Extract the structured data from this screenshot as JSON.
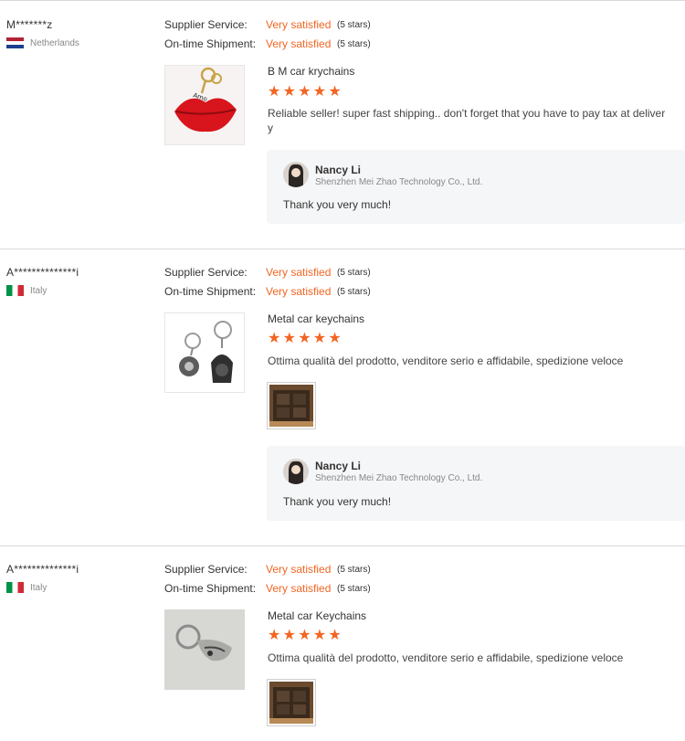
{
  "reviews": [
    {
      "buyer": "M*******z",
      "country": "Netherlands",
      "flag": "netherlands-flag",
      "supplier_label": "Supplier Service:",
      "supplier_value": "Very satisfied",
      "supplier_stars": "(5 stars)",
      "shipment_label": "On-time Shipment:",
      "shipment_value": "Very satisfied",
      "shipment_stars": "(5 stars)",
      "product_title": "B M car krychains",
      "rating": 5,
      "comment": "Reliable seller! super fast shipping.. don't forget that you have to pay tax at deliver y",
      "reply": {
        "name": "Nancy Li",
        "company": "Shenzhen Mei Zhao Technology Co., Ltd.",
        "text": "Thank you very much!"
      }
    },
    {
      "buyer": "A**************i",
      "country": "Italy",
      "flag": "italy-flag",
      "supplier_label": "Supplier Service:",
      "supplier_value": "Very satisfied",
      "supplier_stars": "(5 stars)",
      "shipment_label": "On-time Shipment:",
      "shipment_value": "Very satisfied",
      "shipment_stars": "(5 stars)",
      "product_title": "Metal car keychains",
      "rating": 5,
      "comment": "Ottima qualità del prodotto, venditore serio e affidabile, spedizione veloce",
      "reply": {
        "name": "Nancy Li",
        "company": "Shenzhen Mei Zhao Technology Co., Ltd.",
        "text": "Thank you very much!"
      }
    },
    {
      "buyer": "A**************i",
      "country": "Italy",
      "flag": "italy-flag",
      "supplier_label": "Supplier Service:",
      "supplier_value": "Very satisfied",
      "supplier_stars": "(5 stars)",
      "shipment_label": "On-time Shipment:",
      "shipment_value": "Very satisfied",
      "shipment_stars": "(5 stars)",
      "product_title": "Metal car Keychains",
      "rating": 5,
      "comment": "Ottima qualità del prodotto, venditore serio e affidabile, spedizione veloce"
    }
  ],
  "colors": {
    "accent": "#f26522",
    "reply_bg": "#f5f6f7",
    "divider": "#d9d9d9"
  }
}
